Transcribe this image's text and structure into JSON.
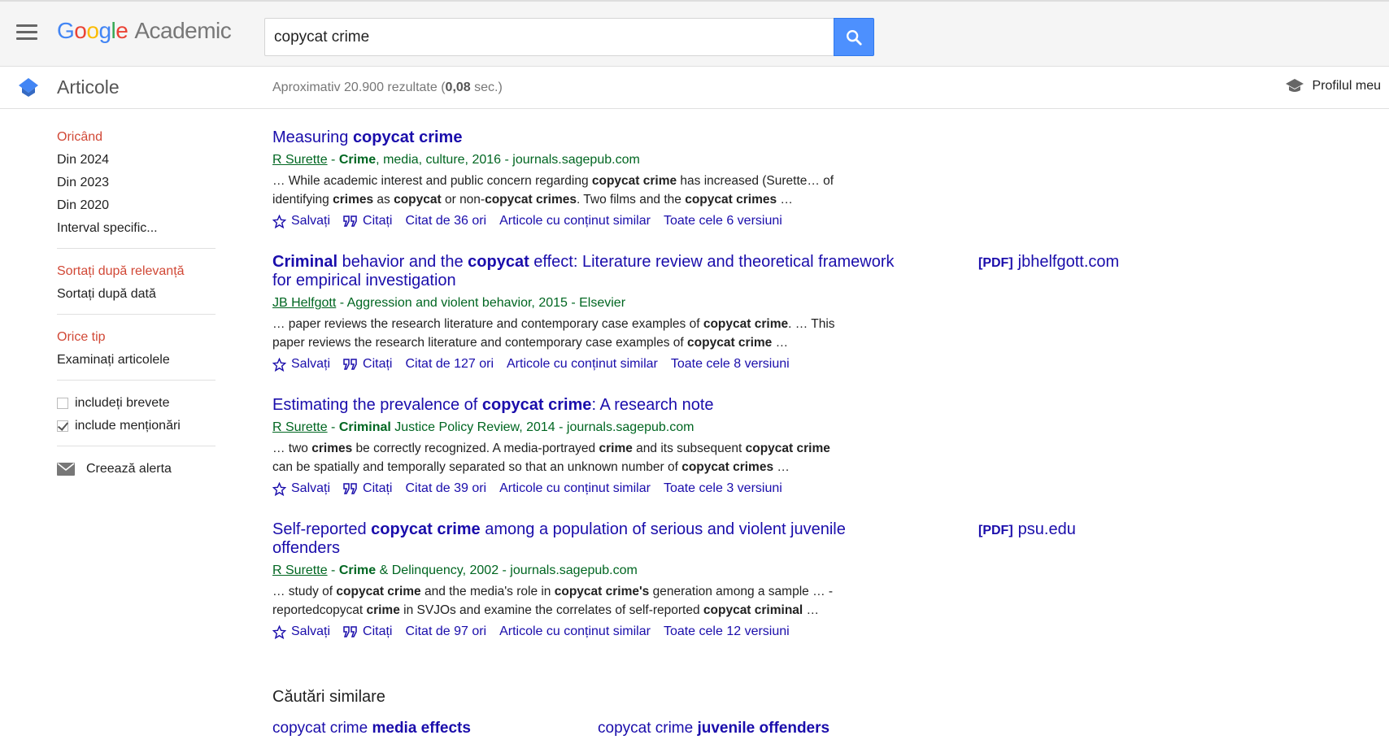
{
  "header": {
    "logo_letters": [
      "G",
      "o",
      "o",
      "g",
      "l",
      "e"
    ],
    "logo_product": "Academic",
    "search_value": "copycat crime"
  },
  "subheader": {
    "title": "Articole",
    "stats_prefix": "Aproximativ 20.900 rezultate (",
    "stats_time": "0,08",
    "stats_suffix": " sec.)",
    "profile_label": "Profilul meu"
  },
  "sidebar": {
    "time_filters": [
      "Oricând",
      "Din 2024",
      "Din 2023",
      "Din 2020",
      "Interval specific..."
    ],
    "sort_options": [
      "Sortați după relevanță",
      "Sortați după dată"
    ],
    "type_options": [
      "Orice tip",
      "Examinați articolele"
    ],
    "checks": [
      {
        "label": "includeți brevete",
        "checked": false
      },
      {
        "label": "include menționări",
        "checked": true
      }
    ],
    "alert_label": "Creează alerta"
  },
  "results": [
    {
      "title_html": "Measuring <b>copycat crime</b>",
      "author": "R Surette",
      "meta_html": " - <b>Crime</b>, media, culture, 2016 - journals.sagepub.com",
      "snippet_html": "… While academic interest and public concern regarding <b>copycat crime</b> has increased (Surette… of identifying <b>crimes</b> as <b>copycat</b> or non-<b>copycat crimes</b>. Two films and the <b>copycat crimes</b> …",
      "cited": "Citat de 36 ori",
      "versions": "Toate cele 6 versiuni",
      "pdf": null
    },
    {
      "title_html": "<b>Criminal</b> behavior and the <b>copycat</b> effect: Literature review and theoretical framework for empirical investigation",
      "author": "JB Helfgott",
      "meta_html": " - Aggression and violent behavior, 2015 - Elsevier",
      "snippet_html": "… paper reviews the research literature and contemporary case examples of <b>copycat crime</b>. … This paper reviews the research literature and contemporary case examples of <b>copycat crime</b> …",
      "cited": "Citat de 127 ori",
      "versions": "Toate cele 8 versiuni",
      "pdf": {
        "tag": "[PDF]",
        "domain": "jbhelfgott.com"
      }
    },
    {
      "title_html": "Estimating the prevalence of <b>copycat crime</b>: A research note",
      "author": "R Surette",
      "meta_html": " - <b>Criminal</b> Justice Policy Review, 2014 - journals.sagepub.com",
      "snippet_html": "… two <b>crimes</b> be correctly recognized. A media-portrayed <b>crime</b> and its subsequent <b>copycat crime</b> can be spatially and temporally separated so that an unknown number of <b>copycat crimes</b> …",
      "cited": "Citat de 39 ori",
      "versions": "Toate cele 3 versiuni",
      "pdf": null
    },
    {
      "title_html": "Self-reported <b>copycat crime</b> among a population of serious and violent juvenile offenders",
      "author": "R Surette",
      "meta_html": " - <b>Crime</b> &amp; Delinquency, 2002 - journals.sagepub.com",
      "snippet_html": "… study of <b>copycat crime</b> and the media's role in <b>copycat crime's</b> generation among a sample … -reportedcopycat <b>crime</b> in SVJOs and examine the correlates of self-reported <b>copycat criminal</b> …",
      "cited": "Citat de 97 ori",
      "versions": "Toate cele 12 versiuni",
      "pdf": {
        "tag": "[PDF]",
        "domain": "psu.edu"
      }
    }
  ],
  "result_links": {
    "save": "Salvați",
    "cite": "Citați",
    "related": "Articole cu conținut similar"
  },
  "related": {
    "title": "Căutări similare",
    "items": [
      {
        "plain": "copycat crime ",
        "bold": "media effects"
      },
      {
        "plain": "copycat crime ",
        "bold": "juvenile offenders"
      }
    ]
  },
  "colors": {
    "link": "#1a0dab",
    "meta_green": "#006621",
    "selected_red": "#d14836",
    "search_blue": "#4d90fe"
  }
}
